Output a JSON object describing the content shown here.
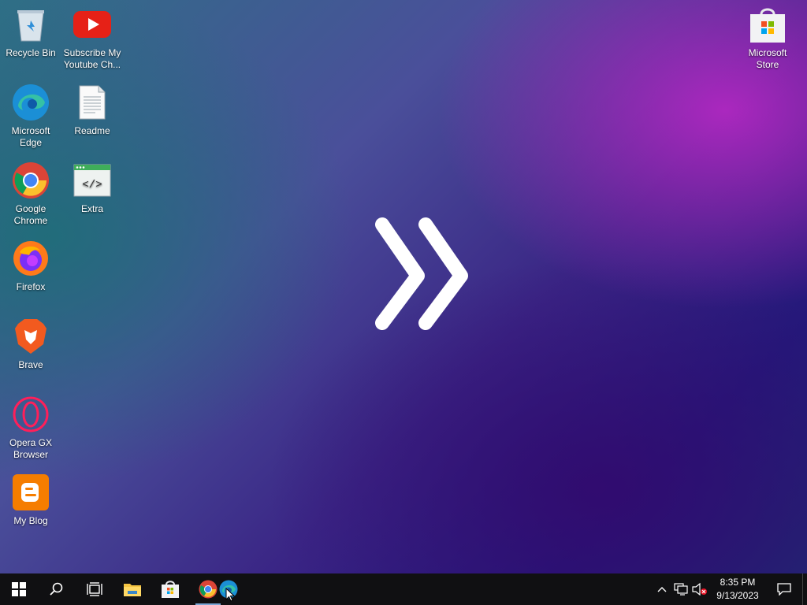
{
  "desktop": {
    "icons": [
      {
        "id": "recycle-bin",
        "label": "Recycle Bin"
      },
      {
        "id": "youtube",
        "label": "Subscribe My Youtube Ch..."
      },
      {
        "id": "edge",
        "label": "Microsoft Edge"
      },
      {
        "id": "readme",
        "label": "Readme"
      },
      {
        "id": "chrome",
        "label": "Google Chrome"
      },
      {
        "id": "extra",
        "label": "Extra"
      },
      {
        "id": "firefox",
        "label": "Firefox"
      },
      {
        "id": "brave",
        "label": "Brave"
      },
      {
        "id": "opera-gx",
        "label": "Opera GX Browser"
      },
      {
        "id": "blog",
        "label": "My Blog"
      },
      {
        "id": "store",
        "label": "Microsoft Store"
      }
    ],
    "wallpaper_logo": "double-chevron-right-icon"
  },
  "taskbar": {
    "buttons": [
      "start-icon",
      "search-icon",
      "task-view-icon",
      "file-explorer-icon",
      "microsoft-store-icon",
      "google-chrome-icon",
      "microsoft-edge-icon"
    ],
    "tray": {
      "icons": [
        "show-hidden-icons-chevron-icon",
        "network-icon",
        "volume-muted-icon"
      ],
      "time": "8:35 PM",
      "date": "9/13/2023"
    }
  },
  "colors": {
    "taskbar": "#101012",
    "accent": "#7aa7d6"
  }
}
